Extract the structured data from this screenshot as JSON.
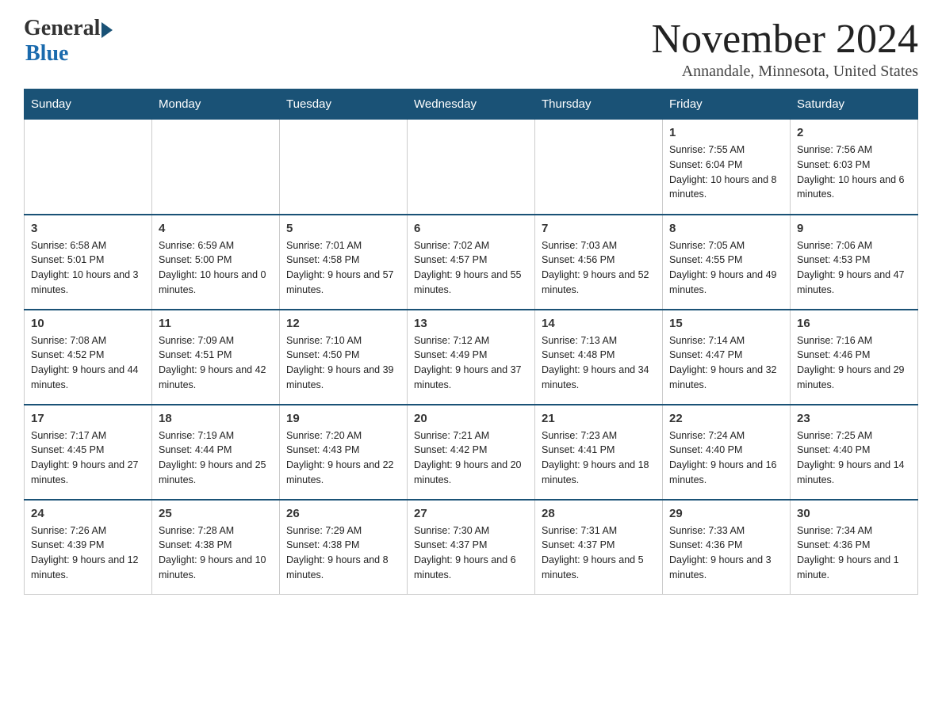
{
  "logo": {
    "general": "General",
    "blue": "Blue"
  },
  "header": {
    "month_title": "November 2024",
    "location": "Annandale, Minnesota, United States"
  },
  "days_of_week": [
    "Sunday",
    "Monday",
    "Tuesday",
    "Wednesday",
    "Thursday",
    "Friday",
    "Saturday"
  ],
  "weeks": [
    [
      {
        "day": "",
        "info": ""
      },
      {
        "day": "",
        "info": ""
      },
      {
        "day": "",
        "info": ""
      },
      {
        "day": "",
        "info": ""
      },
      {
        "day": "",
        "info": ""
      },
      {
        "day": "1",
        "info": "Sunrise: 7:55 AM\nSunset: 6:04 PM\nDaylight: 10 hours and 8 minutes."
      },
      {
        "day": "2",
        "info": "Sunrise: 7:56 AM\nSunset: 6:03 PM\nDaylight: 10 hours and 6 minutes."
      }
    ],
    [
      {
        "day": "3",
        "info": "Sunrise: 6:58 AM\nSunset: 5:01 PM\nDaylight: 10 hours and 3 minutes."
      },
      {
        "day": "4",
        "info": "Sunrise: 6:59 AM\nSunset: 5:00 PM\nDaylight: 10 hours and 0 minutes."
      },
      {
        "day": "5",
        "info": "Sunrise: 7:01 AM\nSunset: 4:58 PM\nDaylight: 9 hours and 57 minutes."
      },
      {
        "day": "6",
        "info": "Sunrise: 7:02 AM\nSunset: 4:57 PM\nDaylight: 9 hours and 55 minutes."
      },
      {
        "day": "7",
        "info": "Sunrise: 7:03 AM\nSunset: 4:56 PM\nDaylight: 9 hours and 52 minutes."
      },
      {
        "day": "8",
        "info": "Sunrise: 7:05 AM\nSunset: 4:55 PM\nDaylight: 9 hours and 49 minutes."
      },
      {
        "day": "9",
        "info": "Sunrise: 7:06 AM\nSunset: 4:53 PM\nDaylight: 9 hours and 47 minutes."
      }
    ],
    [
      {
        "day": "10",
        "info": "Sunrise: 7:08 AM\nSunset: 4:52 PM\nDaylight: 9 hours and 44 minutes."
      },
      {
        "day": "11",
        "info": "Sunrise: 7:09 AM\nSunset: 4:51 PM\nDaylight: 9 hours and 42 minutes."
      },
      {
        "day": "12",
        "info": "Sunrise: 7:10 AM\nSunset: 4:50 PM\nDaylight: 9 hours and 39 minutes."
      },
      {
        "day": "13",
        "info": "Sunrise: 7:12 AM\nSunset: 4:49 PM\nDaylight: 9 hours and 37 minutes."
      },
      {
        "day": "14",
        "info": "Sunrise: 7:13 AM\nSunset: 4:48 PM\nDaylight: 9 hours and 34 minutes."
      },
      {
        "day": "15",
        "info": "Sunrise: 7:14 AM\nSunset: 4:47 PM\nDaylight: 9 hours and 32 minutes."
      },
      {
        "day": "16",
        "info": "Sunrise: 7:16 AM\nSunset: 4:46 PM\nDaylight: 9 hours and 29 minutes."
      }
    ],
    [
      {
        "day": "17",
        "info": "Sunrise: 7:17 AM\nSunset: 4:45 PM\nDaylight: 9 hours and 27 minutes."
      },
      {
        "day": "18",
        "info": "Sunrise: 7:19 AM\nSunset: 4:44 PM\nDaylight: 9 hours and 25 minutes."
      },
      {
        "day": "19",
        "info": "Sunrise: 7:20 AM\nSunset: 4:43 PM\nDaylight: 9 hours and 22 minutes."
      },
      {
        "day": "20",
        "info": "Sunrise: 7:21 AM\nSunset: 4:42 PM\nDaylight: 9 hours and 20 minutes."
      },
      {
        "day": "21",
        "info": "Sunrise: 7:23 AM\nSunset: 4:41 PM\nDaylight: 9 hours and 18 minutes."
      },
      {
        "day": "22",
        "info": "Sunrise: 7:24 AM\nSunset: 4:40 PM\nDaylight: 9 hours and 16 minutes."
      },
      {
        "day": "23",
        "info": "Sunrise: 7:25 AM\nSunset: 4:40 PM\nDaylight: 9 hours and 14 minutes."
      }
    ],
    [
      {
        "day": "24",
        "info": "Sunrise: 7:26 AM\nSunset: 4:39 PM\nDaylight: 9 hours and 12 minutes."
      },
      {
        "day": "25",
        "info": "Sunrise: 7:28 AM\nSunset: 4:38 PM\nDaylight: 9 hours and 10 minutes."
      },
      {
        "day": "26",
        "info": "Sunrise: 7:29 AM\nSunset: 4:38 PM\nDaylight: 9 hours and 8 minutes."
      },
      {
        "day": "27",
        "info": "Sunrise: 7:30 AM\nSunset: 4:37 PM\nDaylight: 9 hours and 6 minutes."
      },
      {
        "day": "28",
        "info": "Sunrise: 7:31 AM\nSunset: 4:37 PM\nDaylight: 9 hours and 5 minutes."
      },
      {
        "day": "29",
        "info": "Sunrise: 7:33 AM\nSunset: 4:36 PM\nDaylight: 9 hours and 3 minutes."
      },
      {
        "day": "30",
        "info": "Sunrise: 7:34 AM\nSunset: 4:36 PM\nDaylight: 9 hours and 1 minute."
      }
    ]
  ]
}
